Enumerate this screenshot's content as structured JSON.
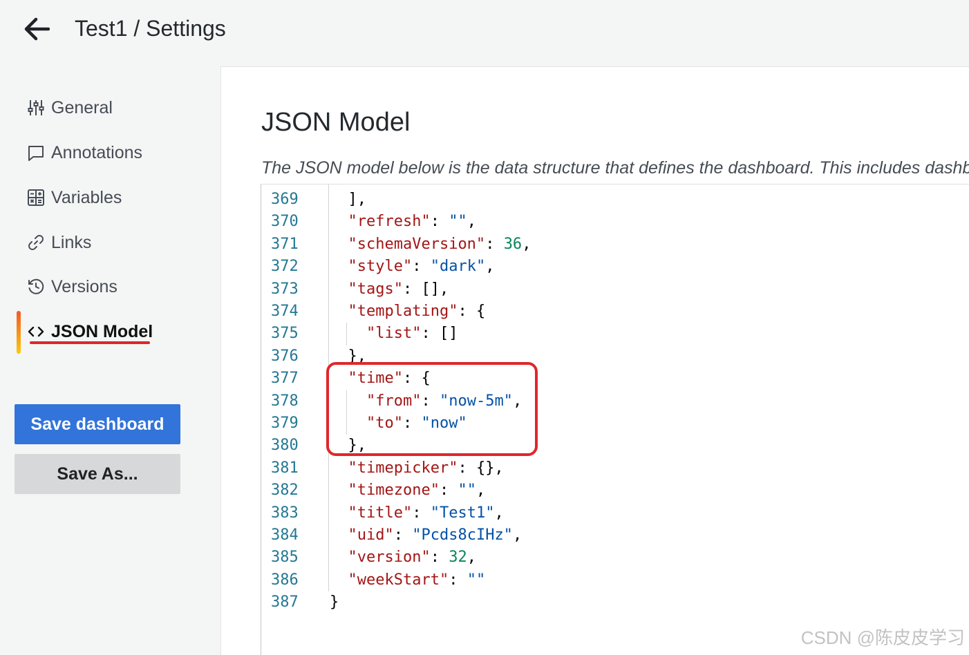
{
  "header": {
    "title": "Test1 / Settings"
  },
  "sidebar": {
    "items": [
      {
        "label": "General",
        "icon": "sliders-icon"
      },
      {
        "label": "Annotations",
        "icon": "comment-icon"
      },
      {
        "label": "Variables",
        "icon": "calculator-icon"
      },
      {
        "label": "Links",
        "icon": "link-icon"
      },
      {
        "label": "Versions",
        "icon": "history-icon"
      },
      {
        "label": "JSON Model",
        "icon": "code-icon",
        "active": true
      }
    ],
    "save_label": "Save dashboard",
    "save_as_label": "Save As..."
  },
  "main": {
    "title": "JSON Model",
    "description": "The JSON model below is the data structure that defines the dashboard. This includes dashboard settings, panel settings, layout, queries, and so on."
  },
  "editor": {
    "lines": [
      {
        "no": "369",
        "tokens": [
          [
            "p",
            "  ],"
          ]
        ]
      },
      {
        "no": "370",
        "tokens": [
          [
            "p",
            "  "
          ],
          [
            "k",
            "\"refresh\""
          ],
          [
            "p",
            ": "
          ],
          [
            "s",
            "\"\""
          ],
          [
            "p",
            ","
          ]
        ]
      },
      {
        "no": "371",
        "tokens": [
          [
            "p",
            "  "
          ],
          [
            "k",
            "\"schemaVersion\""
          ],
          [
            "p",
            ": "
          ],
          [
            "n",
            "36"
          ],
          [
            "p",
            ","
          ]
        ]
      },
      {
        "no": "372",
        "tokens": [
          [
            "p",
            "  "
          ],
          [
            "k",
            "\"style\""
          ],
          [
            "p",
            ": "
          ],
          [
            "s",
            "\"dark\""
          ],
          [
            "p",
            ","
          ]
        ]
      },
      {
        "no": "373",
        "tokens": [
          [
            "p",
            "  "
          ],
          [
            "k",
            "\"tags\""
          ],
          [
            "p",
            ": [],"
          ]
        ]
      },
      {
        "no": "374",
        "tokens": [
          [
            "p",
            "  "
          ],
          [
            "k",
            "\"templating\""
          ],
          [
            "p",
            ": {"
          ]
        ]
      },
      {
        "no": "375",
        "tokens": [
          [
            "p",
            "    "
          ],
          [
            "k",
            "\"list\""
          ],
          [
            "p",
            ": []"
          ]
        ]
      },
      {
        "no": "376",
        "tokens": [
          [
            "p",
            "  },"
          ]
        ]
      },
      {
        "no": "377",
        "tokens": [
          [
            "p",
            "  "
          ],
          [
            "k",
            "\"time\""
          ],
          [
            "p",
            ": {"
          ]
        ]
      },
      {
        "no": "378",
        "tokens": [
          [
            "p",
            "    "
          ],
          [
            "k",
            "\"from\""
          ],
          [
            "p",
            ": "
          ],
          [
            "s",
            "\"now-5m\""
          ],
          [
            "p",
            ","
          ]
        ]
      },
      {
        "no": "379",
        "tokens": [
          [
            "p",
            "    "
          ],
          [
            "k",
            "\"to\""
          ],
          [
            "p",
            ": "
          ],
          [
            "s",
            "\"now\""
          ]
        ]
      },
      {
        "no": "380",
        "tokens": [
          [
            "p",
            "  },"
          ]
        ]
      },
      {
        "no": "381",
        "tokens": [
          [
            "p",
            "  "
          ],
          [
            "k",
            "\"timepicker\""
          ],
          [
            "p",
            ": {},"
          ]
        ]
      },
      {
        "no": "382",
        "tokens": [
          [
            "p",
            "  "
          ],
          [
            "k",
            "\"timezone\""
          ],
          [
            "p",
            ": "
          ],
          [
            "s",
            "\"\""
          ],
          [
            "p",
            ","
          ]
        ]
      },
      {
        "no": "383",
        "tokens": [
          [
            "p",
            "  "
          ],
          [
            "k",
            "\"title\""
          ],
          [
            "p",
            ": "
          ],
          [
            "s",
            "\"Test1\""
          ],
          [
            "p",
            ","
          ]
        ]
      },
      {
        "no": "384",
        "tokens": [
          [
            "p",
            "  "
          ],
          [
            "k",
            "\"uid\""
          ],
          [
            "p",
            ": "
          ],
          [
            "s",
            "\"Pcds8cIHz\""
          ],
          [
            "p",
            ","
          ]
        ]
      },
      {
        "no": "385",
        "tokens": [
          [
            "p",
            "  "
          ],
          [
            "k",
            "\"version\""
          ],
          [
            "p",
            ": "
          ],
          [
            "n",
            "32"
          ],
          [
            "p",
            ","
          ]
        ]
      },
      {
        "no": "386",
        "tokens": [
          [
            "p",
            "  "
          ],
          [
            "k",
            "\"weekStart\""
          ],
          [
            "p",
            ": "
          ],
          [
            "s",
            "\"\""
          ]
        ]
      },
      {
        "no": "387",
        "tokens": [
          [
            "p",
            "}"
          ]
        ]
      }
    ]
  },
  "watermark": "CSDN @陈皮皮学习",
  "colors": {
    "primary": "#3274d9",
    "secondary": "#d7d8d9",
    "highlight": "#e0262b",
    "key": "#a31515",
    "string": "#0451a5",
    "number": "#098658",
    "line_number": "#237893"
  }
}
